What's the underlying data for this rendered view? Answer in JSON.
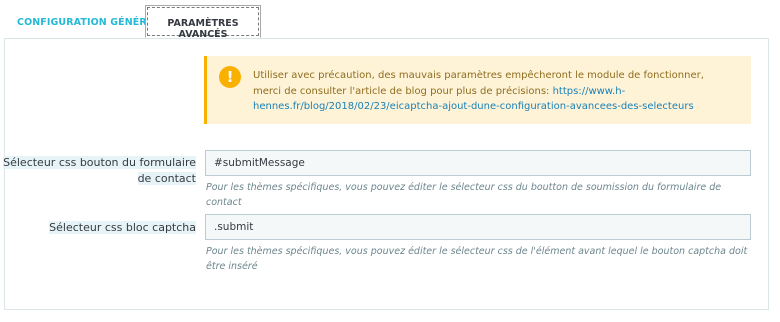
{
  "tabs": {
    "general_label": "CONFIGURATION GÉNÉRALE",
    "advanced_label": "PARAMÈTRES AVANCÉS"
  },
  "alert": {
    "icon": "warning-icon",
    "text": "Utiliser avec précaution, des mauvais paramètres empêcheront le module de fonctionner, merci de consulter l'article de blog pour plus de précisions: ",
    "link": "https://www.h-hennes.fr/blog/2018/02/23/eicaptcha-ajout-dune-configuration-avancees-des-selecteurs"
  },
  "fields": [
    {
      "label": "Sélecteur css bouton du formulaire de contact",
      "value": "#submitMessage",
      "help": "Pour les thèmes spécifiques, vous pouvez éditer le sélecteur css du boutton de soumission du formulaire de contact"
    },
    {
      "label": "Sélecteur css bloc captcha",
      "value": ".submit",
      "help": "Pour les thèmes spécifiques, vous pouvez éditer le sélecteur css de l'élément avant lequel le bouton captcha doit être inséré"
    }
  ],
  "colors": {
    "accent": "#25b9d7",
    "warning": "#fab000",
    "warning_bg": "#fff3d7",
    "link": "#1a80b6"
  }
}
